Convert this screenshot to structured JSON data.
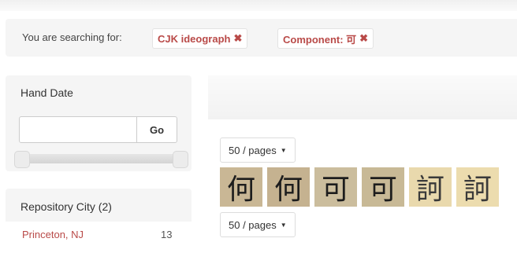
{
  "search": {
    "label": "You are searching for:",
    "filters": [
      {
        "label": "CJK ideograph",
        "remove_icon": "remove-x-icon"
      },
      {
        "label": "Component: 可",
        "remove_icon": "remove-x-icon"
      }
    ]
  },
  "hand_date": {
    "title": "Hand Date",
    "input_value": "",
    "go_label": "Go",
    "range": {
      "min": 0,
      "max": 1
    }
  },
  "repository_city": {
    "title": "Repository City (2)",
    "items": [
      {
        "name": "Princeton, NJ",
        "count": "13"
      }
    ]
  },
  "results": {
    "per_page_top": "50 / pages",
    "per_page_bottom": "50 / pages",
    "thumbnails": [
      {
        "glyph": "何"
      },
      {
        "glyph": "何"
      },
      {
        "glyph": "可"
      },
      {
        "glyph": "可"
      },
      {
        "glyph": "訶"
      },
      {
        "glyph": "訶"
      }
    ]
  },
  "colors": {
    "accent_red": "#b94a48",
    "panel_bg": "#f5f5f5"
  }
}
